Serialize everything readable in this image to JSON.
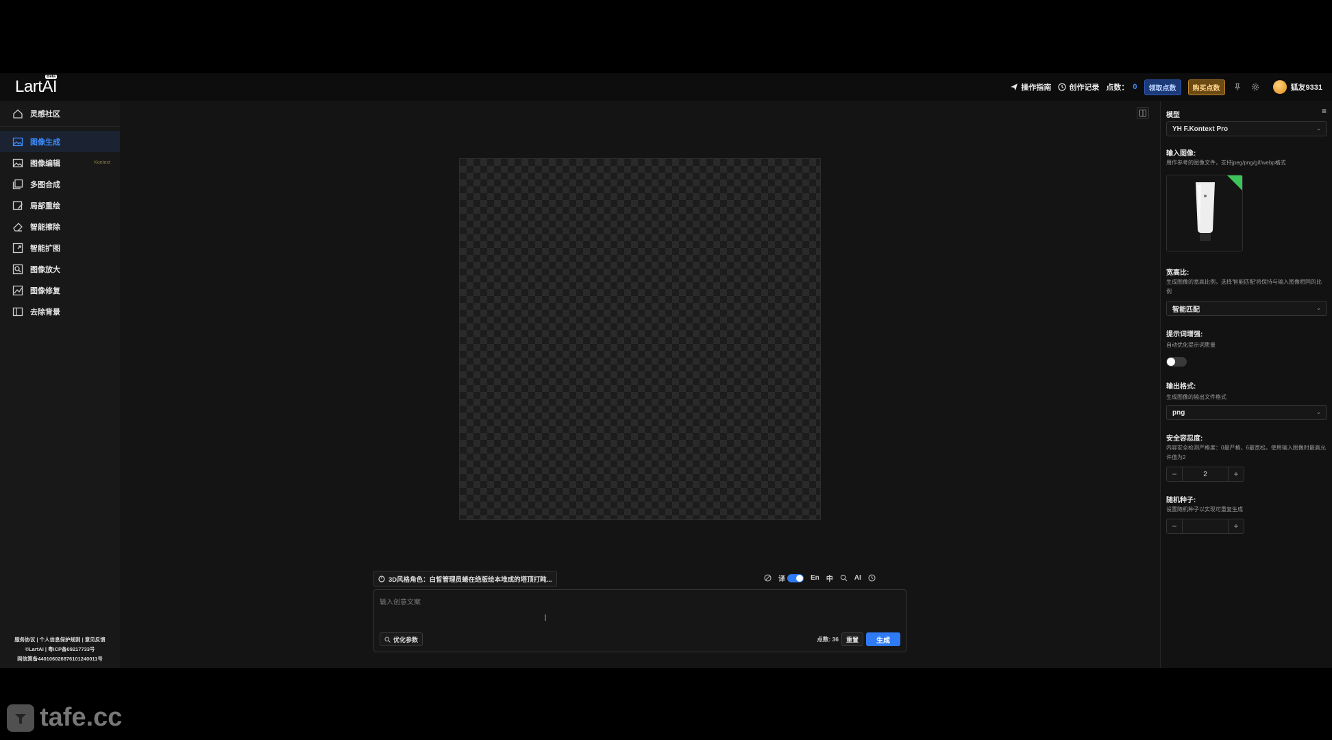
{
  "header": {
    "logo": "LartAI",
    "logo_badge": "Beta",
    "guide": "操作指南",
    "history": "创作记录",
    "points_label": "点数：",
    "points_value": "0",
    "claim_points": "领取点数",
    "buy_points": "购买点数",
    "username": "狐友9331"
  },
  "sidebar": {
    "community": "灵感社区",
    "items": [
      {
        "label": "图像生成",
        "icon": "image-generate-icon"
      },
      {
        "label": "图像编辑",
        "icon": "image-edit-icon",
        "tag": "Kontext"
      },
      {
        "label": "多图合成",
        "icon": "multi-image-icon"
      },
      {
        "label": "局部重绘",
        "icon": "inpaint-icon"
      },
      {
        "label": "智能擦除",
        "icon": "eraser-icon"
      },
      {
        "label": "智能扩图",
        "icon": "outpaint-icon"
      },
      {
        "label": "图像放大",
        "icon": "upscale-icon"
      },
      {
        "label": "图像修复",
        "icon": "restore-icon"
      },
      {
        "label": "去除背景",
        "icon": "remove-bg-icon"
      }
    ],
    "footer": {
      "line1": "服务协议 | 个人信息保护规则 | 意见反馈",
      "line2": "©LartAI | 粤ICP备09217733号",
      "line3": "网信算备440106026876101240011号"
    }
  },
  "main": {
    "preset": "3D风格角色：白皙管理员蜷在绝版绘本堆成的塔顶打盹...",
    "translate_label": "译",
    "lang_en": "En",
    "lang_zh": "中",
    "ai_label": "AI",
    "prompt_placeholder": "输入创意文案",
    "optimize": "优化参数",
    "cost": "点数: 36",
    "reset": "重置",
    "generate": "生成"
  },
  "settings": {
    "model_label": "模型",
    "model_value": "YH F.Kontext Pro",
    "input_image_label": "输入图像:",
    "input_image_desc": "用作参考的图像文件，支持jpeg/png/gif/webp格式",
    "aspect_label": "宽高比:",
    "aspect_desc": "生成图像的宽高比例，选择'智能匹配'将保持与输入图像相同的比例",
    "aspect_value": "智能匹配",
    "enhance_label": "提示词增强:",
    "enhance_desc": "自动优化提示词质量",
    "enhance_on": false,
    "format_label": "输出格式:",
    "format_desc": "生成图像的输出文件格式",
    "format_value": "png",
    "safety_label": "安全容忍度:",
    "safety_desc": "内容安全检测严格度：0最严格，6最宽松。使用输入图像时最高允许值为2",
    "safety_value": "2",
    "seed_label": "随机种子:",
    "seed_desc": "设置随机种子以实现可重复生成",
    "seed_value": ""
  },
  "watermark": "tafe.cc",
  "colors": {
    "accent": "#2f7bf5",
    "buy": "#c3842a",
    "background": "#121212"
  }
}
